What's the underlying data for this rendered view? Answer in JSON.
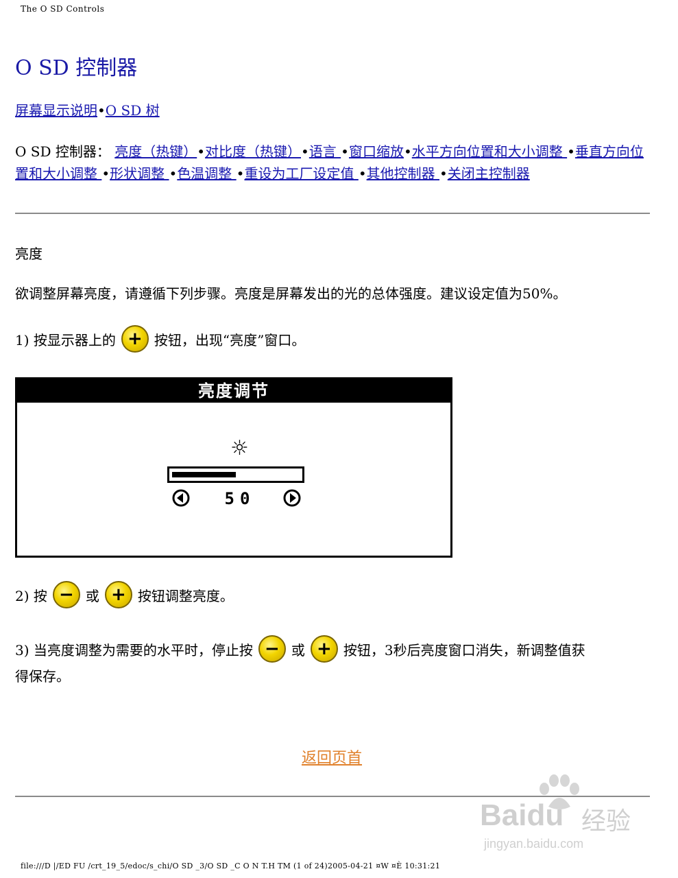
{
  "header": {
    "title": "The O SD Controls"
  },
  "page_title": "O SD 控制器",
  "sub_nav": {
    "link1": "屏幕显示说明",
    "sep": "•",
    "link2": "O SD 树 "
  },
  "controls_nav": {
    "prefix": "O SD 控制器：",
    "items": [
      "亮度（热键）",
      "对比度（热键）",
      "语言 ",
      "窗口缩放",
      "水平方向位置和大小调整 ",
      "垂直方向位置和大小调整 ",
      "形状调整 ",
      "色温调整 ",
      "重设为工厂设定值 ",
      "其他控制器 ",
      "关闭主控制器"
    ],
    "sep": "•"
  },
  "section": {
    "title": "亮度",
    "intro": "欲调整屏幕亮度，请遵循下列步骤。亮度是屏幕发出的光的总体强度。建议设定值为50%。"
  },
  "steps": {
    "s1_pre": "1) 按显示器上的",
    "s1_post": "按钮，出现“亮度”窗口。",
    "s2_pre": "2) 按",
    "s2_mid": "或",
    "s2_post": "按钮调整亮度。",
    "s3_pre": "3) 当亮度调整为需要的水平时，停止按",
    "s3_mid": "或",
    "s3_post": "按钮，3秒后亮度窗口消失，新调整值获",
    "s3_line2": "得保存。"
  },
  "osd_window": {
    "title": "亮度调节",
    "sun_icon": "sun-icon",
    "value": "50",
    "level_fraction": 0.5
  },
  "icons": {
    "plus": "+",
    "minus": "−"
  },
  "colors": {
    "link": "#1a1ab0",
    "back_top": "#e0802a",
    "button_yellow": "#f2d400"
  },
  "back_to_top": "返回页首",
  "footer": "file:///D |/ED FU /crt_19_5/edoc/s_chi/O SD _3/O SD _C O N T.H TM  (1 of 24)2005-04-21 ¤W ¤È  10:31:21",
  "watermark": {
    "brand": "Baidu",
    "brand_cn": "经验",
    "url": "jingyan.baidu.com"
  }
}
